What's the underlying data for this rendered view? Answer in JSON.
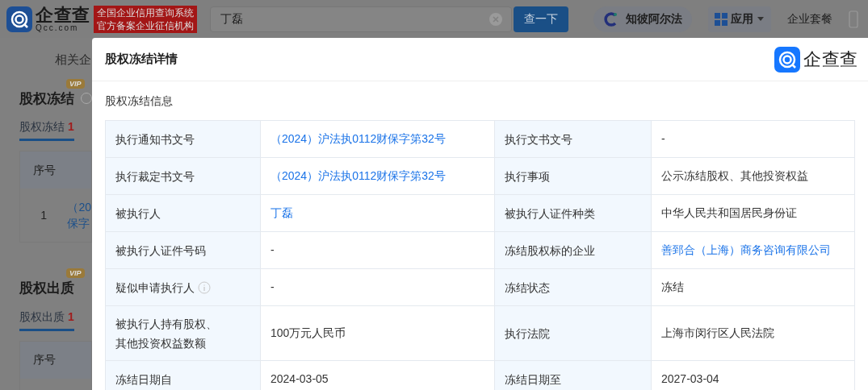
{
  "header": {
    "logo": {
      "name": "企查查",
      "domain": "Qcc.com"
    },
    "slogan": [
      "全国企业信用查询系统",
      "官方备案企业征信机构"
    ],
    "search": {
      "value": "丁磊"
    },
    "search_button": "查一下",
    "nav": [
      {
        "kind": "alpha",
        "label": "知彼阿尔法"
      },
      {
        "kind": "apps",
        "label": "应用"
      },
      {
        "kind": "text",
        "label": "企业套餐"
      }
    ]
  },
  "background": {
    "nav_text": "相关企",
    "sections": [
      {
        "title": "股权冻结",
        "badge": "VIP",
        "tab": {
          "label": "股权冻结",
          "count": "1",
          "selected": true
        },
        "column": "序号",
        "rows": [
          {
            "index": "1",
            "link": [
              "（20",
              "保字"
            ]
          }
        ]
      },
      {
        "title": "股权出质",
        "badge": "VIP",
        "tab": {
          "label": "股权出质",
          "count": "1",
          "selected": true
        },
        "column": "序号"
      }
    ]
  },
  "modal": {
    "title": "股权冻结详情",
    "brand": "企查查",
    "section": "股权冻结信息",
    "rows": [
      [
        {
          "label": "执行通知书文号",
          "value": "（2024）沪法执0112财保字第32号",
          "link": true
        },
        {
          "label": "执行文书文号",
          "value": "-",
          "link": false
        }
      ],
      [
        {
          "label": "执行裁定书文号",
          "value": "（2024）沪法执0112财保字第32号",
          "link": true
        },
        {
          "label": "执行事项",
          "value": "公示冻结股权、其他投资权益",
          "link": false
        }
      ],
      [
        {
          "label": "被执行人",
          "value": "丁磊",
          "link": true
        },
        {
          "label": "被执行人证件种类",
          "value": "中华人民共和国居民身份证",
          "link": false
        }
      ],
      [
        {
          "label": "被执行人证件号码",
          "value": "-",
          "link": false
        },
        {
          "label": "冻结股权标的企业",
          "value": "善郅合（上海）商务咨询有限公司",
          "link": true
        }
      ],
      [
        {
          "label": "疑似申请执行人",
          "info": true,
          "value": "-",
          "link": false
        },
        {
          "label": "冻结状态",
          "value": "冻结",
          "link": false
        }
      ],
      [
        {
          "label": [
            "被执行人持有股权、",
            "其他投资权益数额"
          ],
          "value": "100万元人民币",
          "link": false
        },
        {
          "label": "执行法院",
          "value": "上海市闵行区人民法院",
          "link": false
        }
      ],
      [
        {
          "label": "冻结日期自",
          "value": "2024-03-05",
          "link": false
        },
        {
          "label": "冻结日期至",
          "value": "2027-03-04",
          "link": false
        }
      ]
    ]
  }
}
